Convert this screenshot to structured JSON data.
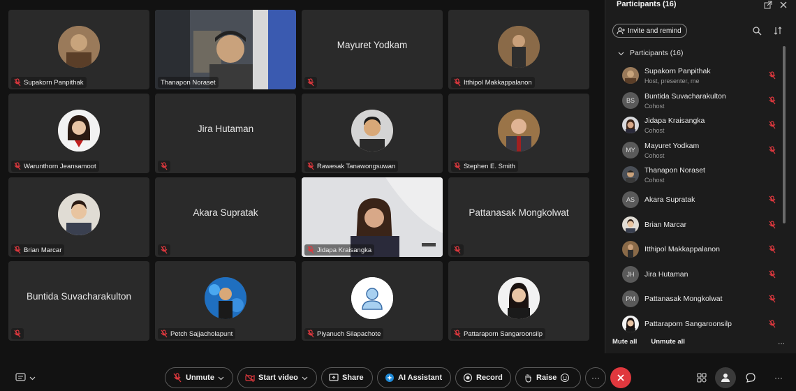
{
  "tiles": [
    {
      "name": "Supakorn Panpithak",
      "type": "avatar",
      "color": "#8b6b4a"
    },
    {
      "name": "Thanapon Noraset",
      "type": "video"
    },
    {
      "name": "Mayuret Yodkam",
      "type": "name"
    },
    {
      "name": "Itthipol Makkappalanon",
      "type": "avatar",
      "color": "#7a5a3a"
    },
    {
      "name": "Warunthorn Jeansamoot",
      "type": "avatar",
      "color": "#e0e0e0"
    },
    {
      "name": "Jira Hutaman",
      "type": "name"
    },
    {
      "name": "Rawesak Tanawongsuwan",
      "type": "avatar",
      "color": "#c9c9c9"
    },
    {
      "name": "Stephen E. Smith",
      "type": "avatar",
      "color": "#8a6a4a"
    },
    {
      "name": "Brian Marcar",
      "type": "avatar",
      "color": "#d9d4cc"
    },
    {
      "name": "Akara Supratak",
      "type": "name"
    },
    {
      "name": "Jidapa Kraisangka",
      "type": "video"
    },
    {
      "name": "Pattanasak Mongkolwat",
      "type": "name"
    },
    {
      "name": "Buntida Suvacharakulton",
      "type": "name"
    },
    {
      "name": "Petch Sajjacholapunt",
      "type": "avatar",
      "color": "#2a6fb0"
    },
    {
      "name": "Piyanuch Silapachote",
      "type": "avatar",
      "color": "#ffffff"
    },
    {
      "name": "Pattaraporn Sangaroonsilp",
      "type": "avatar",
      "color": "#f0f0f0"
    }
  ],
  "panel": {
    "title": "Participants (16)",
    "invite_label": "Invite and remind",
    "section_label": "Participants (16)",
    "mute_all": "Mute all",
    "unmute_all": "Unmute all",
    "more": "...",
    "participants": [
      {
        "name": "Supakorn Panpithak",
        "role": "Host, presenter, me",
        "initials": ""
      },
      {
        "name": "Buntida Suvacharakulton",
        "role": "Cohost",
        "initials": "BS"
      },
      {
        "name": "Jidapa Kraisangka",
        "role": "Cohost",
        "initials": ""
      },
      {
        "name": "Mayuret Yodkam",
        "role": "Cohost",
        "initials": "MY"
      },
      {
        "name": "Thanapon Noraset",
        "role": "Cohost",
        "initials": ""
      },
      {
        "name": "Akara Supratak",
        "role": "",
        "initials": "AS"
      },
      {
        "name": "Brian Marcar",
        "role": "",
        "initials": ""
      },
      {
        "name": "Itthipol Makkappalanon",
        "role": "",
        "initials": ""
      },
      {
        "name": "Jira Hutaman",
        "role": "",
        "initials": "JH"
      },
      {
        "name": "Pattanasak Mongkolwat",
        "role": "",
        "initials": "PM"
      },
      {
        "name": "Pattaraporn Sangaroonsilp",
        "role": "",
        "initials": ""
      }
    ]
  },
  "toolbar": {
    "unmute": "Unmute",
    "start_video": "Start video",
    "share": "Share",
    "ai_assistant": "AI Assistant",
    "record": "Record",
    "raise": "Raise",
    "more": "···"
  },
  "colors": {
    "mic_off": "#e0383e",
    "end_call": "#e0383e",
    "tile_bg": "#2a2a2a",
    "panel_bg": "#1c1c1c"
  }
}
